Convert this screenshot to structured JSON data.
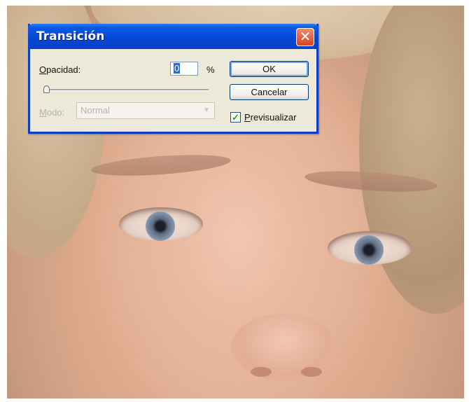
{
  "dialog": {
    "title": "Transición",
    "close_glyph": "✕",
    "opacity": {
      "label_underlined": "O",
      "label_rest": "pacidad:",
      "value": "0",
      "unit": "%",
      "slider_fraction": 0.0
    },
    "mode": {
      "label_underlined": "M",
      "label_rest": "odo:",
      "selected": "Normal",
      "enabled": false
    },
    "buttons": {
      "ok": "OK",
      "cancel": "Cancelar"
    },
    "preview": {
      "checked": true,
      "label_underlined": "P",
      "label_rest": "revisualizar"
    }
  },
  "colors": {
    "titlebar": "#0a3fc4",
    "dialog_bg": "#ece9d8",
    "close_button": "#d6441e",
    "check": "#21a121"
  },
  "icons": {
    "close": "close-icon",
    "checkmark": "checkmark-icon",
    "dropdown": "chevron-down-icon",
    "slider_thumb": "slider-thumb"
  }
}
